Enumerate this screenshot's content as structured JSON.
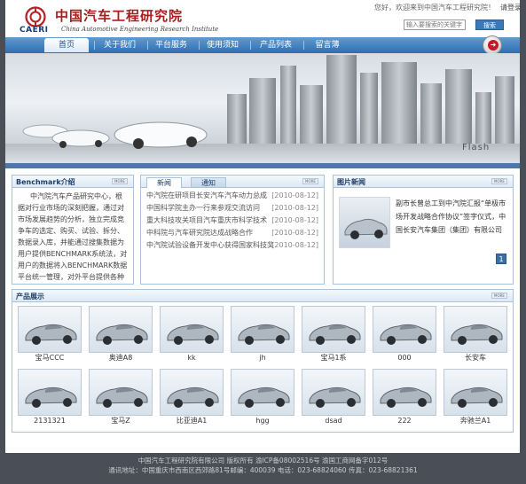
{
  "brand": {
    "logo_abbr": "CAERI",
    "name_cn": "中国汽车工程研究院",
    "name_en": "China Automotive Engineering Research Institute"
  },
  "topbar": {
    "welcome": "您好，欢迎来到中国汽车工程研究院！",
    "login": "请登录",
    "search_placeholder": "输入要搜索的关键字",
    "search_button": "搜索"
  },
  "nav": {
    "items": [
      "首页",
      "关于我们",
      "平台服务",
      "使用须知",
      "产品列表",
      "留言薄"
    ],
    "active_index": 0
  },
  "banner": {
    "label": "Flash"
  },
  "benchmark": {
    "title": "Benchmark介绍",
    "more": "MORE",
    "text": "中汽院汽车产品研究中心，根据对行业市场的深刻把握，通过对市场发展趋势的分析，独立完成竞争车的选定、购买、试验、拆分、数据录入库，并能通过搜集数据为用户提供BENCHMARK系统法，对用户的数据将入BENCHMARK数据平台统一管理，对外平台提供各种数据系统，方便用户使用，以及各用户、中级等有控制"
  },
  "news": {
    "tab_news": "新闻",
    "tab_notice": "通知",
    "more": "MORE",
    "items": [
      {
        "title": "中汽院在研项目长安汽车汽车动力总成",
        "date": "[2010-08-12]"
      },
      {
        "title": "中国科学院主办一行来参观交流访问",
        "date": "[2010-08-12]"
      },
      {
        "title": "重大科技攻关项目汽车重庆市科学技术",
        "date": "[2010-08-12]"
      },
      {
        "title": "中科院与汽车研究院达成战略合作",
        "date": "[2010-08-12]"
      },
      {
        "title": "中汽院试验设备开发中心获得国家科技奖",
        "date": "[2010-08-12]"
      }
    ]
  },
  "picture_news": {
    "title": "图片新闻",
    "more": "MORE",
    "text": "副市长曾总工到中汽院汇报“单极市场开发战略合作协议”签字仪式，中国长安汽车集团（集团）有限公司",
    "page": "1"
  },
  "products": {
    "title": "产品展示",
    "more": "MORE",
    "items": [
      "宝马CCC",
      "奥迪A8",
      "kk",
      "jh",
      "宝马1系",
      "000",
      "长安车",
      "2131321",
      "宝马Z",
      "比亚迪A1",
      "hgg",
      "dsad",
      "222",
      "奔驰兰A1"
    ]
  },
  "footer": {
    "line1": "中国汽车工程研究院有限公司 版权所有 渝ICP备08002516号 渝国工商网备字012号",
    "line2": "通讯地址：中国重庆市西南区西郊路81号邮编：400039 电话：023-68824060 传真：023-68821361"
  }
}
